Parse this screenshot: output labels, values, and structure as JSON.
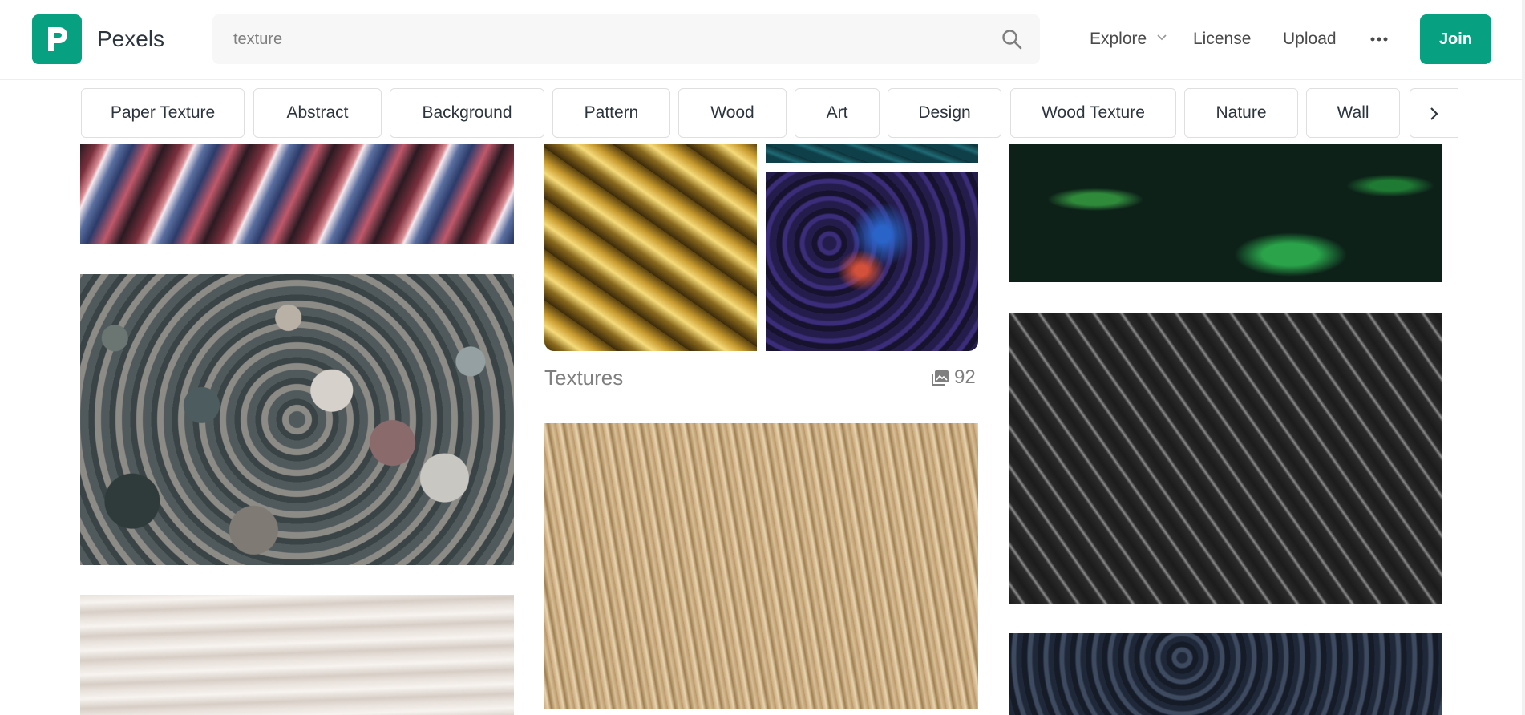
{
  "colors": {
    "brand": "#07a081",
    "text": "#2c343e",
    "muted": "#7f7f7f"
  },
  "header": {
    "logo_text": "Pexels",
    "search_value": "texture",
    "nav": {
      "explore": "Explore",
      "license": "License",
      "upload": "Upload"
    },
    "join_label": "Join",
    "icons": [
      "pexels-logo-icon",
      "search-icon",
      "chevron-down-icon",
      "more-icon"
    ]
  },
  "tags": [
    "Paper Texture",
    "Abstract",
    "Background",
    "Pattern",
    "Wood",
    "Art",
    "Design",
    "Wood Texture",
    "Nature",
    "Wall"
  ],
  "collection": {
    "title": "Textures",
    "count": "92"
  }
}
